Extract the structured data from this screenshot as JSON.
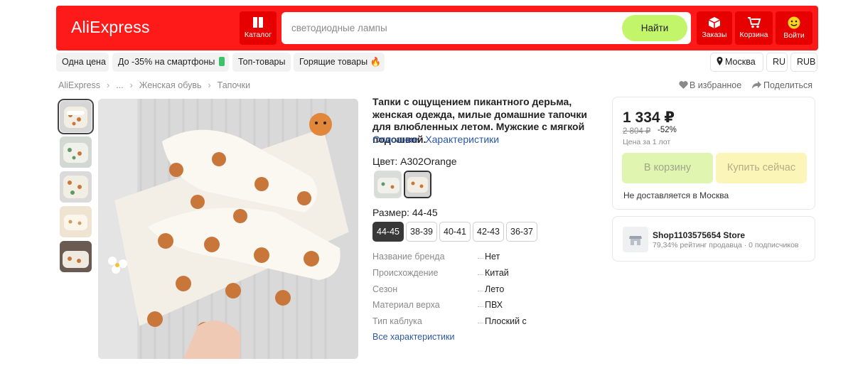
{
  "header": {
    "logo": "AliExpress",
    "catalog_label": "Каталог",
    "search_placeholder": "светодиодные лампы",
    "search_button": "Найти",
    "orders_label": "Заказы",
    "cart_label": "Корзина",
    "login_label": "Войти"
  },
  "promo_nav": {
    "items": [
      "Одна цена",
      "До -35% на смартфоны",
      "Топ-товары",
      "Горящие товары"
    ],
    "location": "Москва",
    "language": "RU",
    "currency": "RUB"
  },
  "breadcrumb": [
    "AliExpress",
    "...",
    "Женская обувь",
    "Тапочки"
  ],
  "actions": {
    "favorite": "В избранное",
    "share": "Поделиться"
  },
  "product": {
    "title": "Тапки с ощущением пикантного дерьма, женская одежда, милые домашние тапочки для влюбленных летом. Мужские с мягкой подошвой.",
    "tabs": [
      "Описание",
      "Характеристики"
    ],
    "color_label": "Цвет: A302Orange",
    "size_label": "Размер: 44-45",
    "sizes": [
      "44-45",
      "38-39",
      "40-41",
      "42-43",
      "36-37"
    ],
    "selected_size": "44-45",
    "specs": [
      {
        "key": "Название бренда",
        "value": "Нет"
      },
      {
        "key": "Происхождение",
        "value": "Китай"
      },
      {
        "key": "Сезон",
        "value": "Лето"
      },
      {
        "key": "Материал верха",
        "value": "ПВХ"
      },
      {
        "key": "Тип каблука",
        "value": "Плоский с"
      }
    ],
    "all_specs_link": "Все характеристики"
  },
  "buybox": {
    "price": "1 334 ₽",
    "old_price": "2 804 ₽",
    "discount": "-52%",
    "per_lot": "Цена за 1 лот",
    "cart_button": "В корзину",
    "buy_button": "Купить сейчас",
    "delivery_note": "Не доставляется в Москва"
  },
  "store": {
    "name": "Shop1103575654 Store",
    "rating": "79,34% рейтинг продавца",
    "followers": "0 подписчиков"
  },
  "colors": {
    "brand_red": "#ff1a1a",
    "search_button": "#c3f56b",
    "link_blue": "#2b57a8"
  }
}
